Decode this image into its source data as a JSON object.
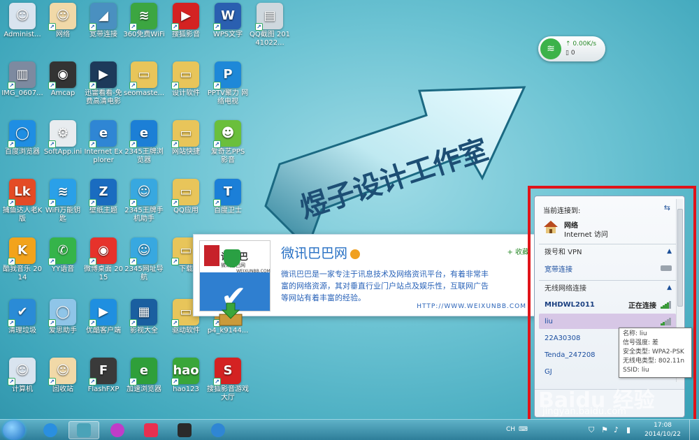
{
  "desktop_icons": [
    {
      "label": "Administ...",
      "glyph": "☺",
      "color": "#d9e4ef"
    },
    {
      "label": "网络",
      "glyph": "☺",
      "color": "#f1d9a8"
    },
    {
      "label": "宽带连接",
      "glyph": "◢",
      "color": "#4a90c0"
    },
    {
      "label": "360免费WiFi",
      "glyph": "≋",
      "color": "#3ca641"
    },
    {
      "label": "搜狐影音",
      "glyph": "▶",
      "color": "#d42222"
    },
    {
      "label": "WPS文字",
      "glyph": "W",
      "color": "#2a5fb0"
    },
    {
      "label": "QQ截图 20141022...",
      "glyph": "▤",
      "color": "#cfd8de"
    },
    {
      "label": "IMG_0607...",
      "glyph": "▥",
      "color": "#7d8aa0"
    },
    {
      "label": "Amcap",
      "glyph": "◉",
      "color": "#333333"
    },
    {
      "label": "迅雷看看-免费高清电影",
      "glyph": "▶",
      "color": "#1d3a5a"
    },
    {
      "label": "seomaste...",
      "glyph": "▭",
      "color": "#e8c55a"
    },
    {
      "label": "设计软件",
      "glyph": "▭",
      "color": "#e8c55a"
    },
    {
      "label": "PPTV聚力 网络电视",
      "glyph": "P",
      "color": "#1e88d8"
    },
    {
      "label": "百度浏览器",
      "glyph": "◯",
      "color": "#1f8ee3"
    },
    {
      "label": "SoftApp.ini",
      "glyph": "⚙",
      "color": "#e8ecef"
    },
    {
      "label": "Internet Explorer",
      "glyph": "e",
      "color": "#2f86d4"
    },
    {
      "label": "2345王牌浏览器",
      "glyph": "e",
      "color": "#1c7fd6"
    },
    {
      "label": "网站快捷",
      "glyph": "▭",
      "color": "#e8c55a"
    },
    {
      "label": "爱奇艺PPS 影音",
      "glyph": "☻",
      "color": "#6abf3c"
    },
    {
      "label": "捕鱼达人老K版",
      "glyph": "Lk",
      "color": "#e44b25"
    },
    {
      "label": "WiFi万能钥匙",
      "glyph": "≋",
      "color": "#2aa0e8"
    },
    {
      "label": "壁纸主题",
      "glyph": "Z",
      "color": "#1a6cc0"
    },
    {
      "label": "2345王牌手机助手",
      "glyph": "☺",
      "color": "#38a8e0"
    },
    {
      "label": "QQ应用",
      "glyph": "▭",
      "color": "#e8c55a"
    },
    {
      "label": "百度卫士",
      "glyph": "T",
      "color": "#1b7fd8"
    },
    {
      "label": "酷我音乐 2014",
      "glyph": "K",
      "color": "#f2a31c"
    },
    {
      "label": "YY语音",
      "glyph": "✆",
      "color": "#35b44a"
    },
    {
      "label": "微博桌面 2015",
      "glyph": "◉",
      "color": "#e6322b"
    },
    {
      "label": "2345网址导航",
      "glyph": "☺",
      "color": "#38a8e0"
    },
    {
      "label": "下载",
      "glyph": "▭",
      "color": "#e8c55a"
    },
    {
      "label": "清理垃圾",
      "glyph": "✔",
      "color": "#2a8bd6"
    },
    {
      "label": "爱思助手",
      "glyph": "◯",
      "color": "#8fc5e8"
    },
    {
      "label": "优酷客户端",
      "glyph": "▶",
      "color": "#1f8fe0"
    },
    {
      "label": "影视大全",
      "glyph": "▦",
      "color": "#1a5fa0"
    },
    {
      "label": "驱动软件",
      "glyph": "▭",
      "color": "#e8c55a"
    },
    {
      "label": "p4_k9144...",
      "glyph": "▣",
      "color": "#d9a640"
    },
    {
      "label": "计算机",
      "glyph": "☺",
      "color": "#d9e4ef"
    },
    {
      "label": "回收站",
      "glyph": "☺",
      "color": "#f1d9a8"
    },
    {
      "label": "FlashFXP",
      "glyph": "F",
      "color": "#3a3a3a"
    },
    {
      "label": "加速浏览器",
      "glyph": "e",
      "color": "#2f9f3a"
    },
    {
      "label": "hao123",
      "glyph": "hao",
      "color": "#3aa63a"
    },
    {
      "label": "搜狐影音游戏大厅",
      "glyph": "S",
      "color": "#d42222"
    }
  ],
  "banner": {
    "text": "煜子设计工作室"
  },
  "speed_widget": {
    "up": "0.00K/s",
    "down": "0"
  },
  "card": {
    "logo_text": "讯巴巴",
    "logo_site": "微讯巴巴网",
    "logo_url": "WEIXUNBB.COM",
    "title": "微讯巴巴网",
    "fav": "+ 收藏",
    "description": "微讯巴巴是一家专注于讯息技术及网络资讯平台，有着非常丰富的网络资源，其对垂直行业门户站点及娱乐性，互联网广告等网站有着丰富的经验。",
    "url": "HTTP://WWW.WEIXUNBB.COM"
  },
  "network_panel": {
    "connected_to": "当前连接到:",
    "current_name": "网络",
    "current_status": "Internet 访问",
    "dialup_section": "拨号和 VPN",
    "broadband": "宽带连接",
    "wireless_section": "无线网络连接",
    "networks": [
      {
        "name": "MHDWL2011",
        "status": "正在连接",
        "bars": 4
      },
      {
        "name": "liu",
        "status": "",
        "bars": 2
      },
      {
        "name": "22A30308",
        "status": "",
        "bars": 2
      },
      {
        "name": "Tenda_247208",
        "status": "",
        "bars": 2
      },
      {
        "name": "GJ",
        "status": "",
        "bars": 2
      }
    ]
  },
  "tooltip": {
    "lines": [
      "名称: liu",
      "信号强度: 差",
      "安全类型: WPA2-PSK",
      "无线电类型: 802.11n",
      "SSID: liu"
    ]
  },
  "taskbar": {
    "lang": "CH",
    "time": "17:08",
    "date": "2014/10/22"
  },
  "watermark": {
    "logo": "Baidu 经验",
    "site": "jingyan.baidu.com"
  }
}
